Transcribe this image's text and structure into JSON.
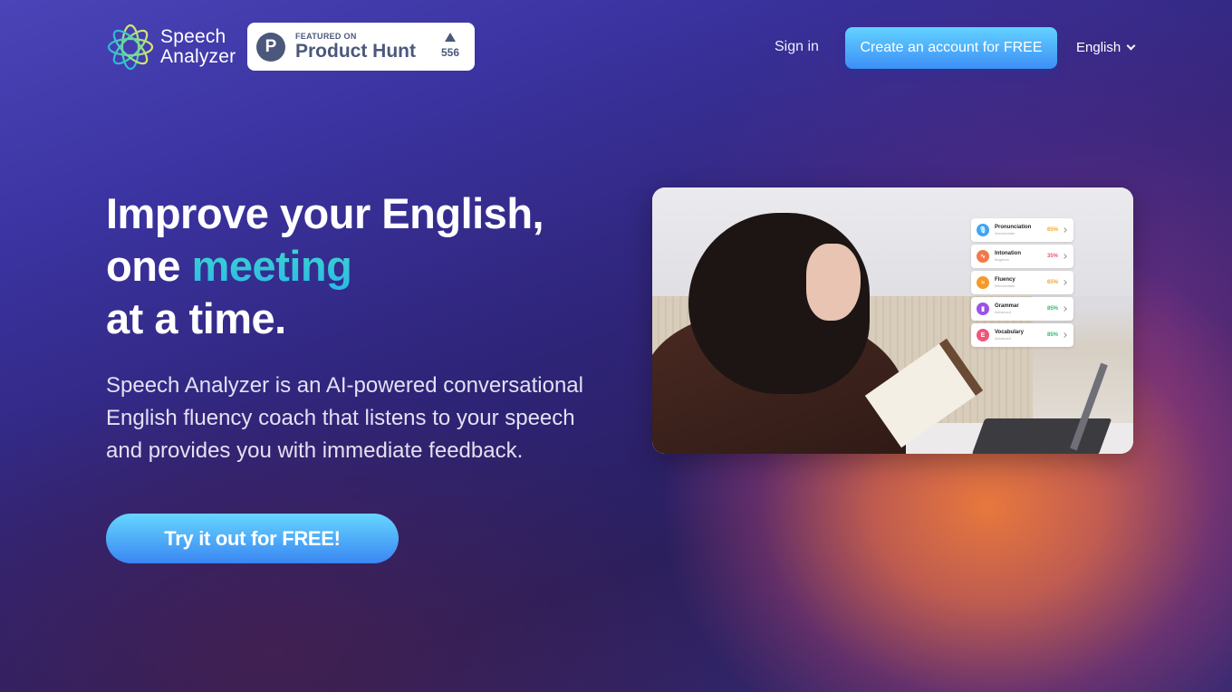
{
  "header": {
    "logo": {
      "line1": "Speech",
      "line2": "Analyzer",
      "icon": "star-wave-logo-icon"
    },
    "product_hunt": {
      "letter": "P",
      "featured_label": "FEATURED ON",
      "name": "Product Hunt",
      "votes": "556",
      "icon": "upvote-triangle-icon"
    },
    "sign_in": "Sign in",
    "create_account": "Create an account for FREE",
    "language": {
      "selected": "English",
      "icon": "chevron-down-icon"
    }
  },
  "hero": {
    "headline": {
      "line1": "Improve your English,",
      "line2_prefix": "one ",
      "line2_accent": "meeting",
      "line3": "at a time."
    },
    "description": "Speech Analyzer is an AI-powered conversational English fluency coach that listens to your speech and provides you with immediate feedback.",
    "cta": "Try it out for FREE!"
  },
  "scores": [
    {
      "name": "Pronunciation",
      "level": "Intermediate",
      "percent": "65%",
      "color": "#f5a623",
      "icon_bg": "#3ea5f5",
      "icon": "microphone-icon",
      "glyph": "🎙"
    },
    {
      "name": "Intonation",
      "level": "Beginner",
      "percent": "35%",
      "color": "#e8577a",
      "icon_bg": "#f2784b",
      "icon": "waveform-icon",
      "glyph": "∿"
    },
    {
      "name": "Fluency",
      "level": "Intermediate",
      "percent": "65%",
      "color": "#f5a623",
      "icon_bg": "#f59a2a",
      "icon": "waves-icon",
      "glyph": "≈"
    },
    {
      "name": "Grammar",
      "level": "Advanced",
      "percent": "85%",
      "color": "#2fb872",
      "icon_bg": "#9b52e8",
      "icon": "book-icon",
      "glyph": "▮"
    },
    {
      "name": "Vocabulary",
      "level": "Advanced",
      "percent": "85%",
      "color": "#2fb872",
      "icon_bg": "#f2557a",
      "icon": "letter-e-icon",
      "glyph": "E"
    }
  ],
  "colors": {
    "accent_teal": "#3fd8c8",
    "button_blue": "#3d8ff6",
    "product_hunt_slate": "#4b587c"
  }
}
